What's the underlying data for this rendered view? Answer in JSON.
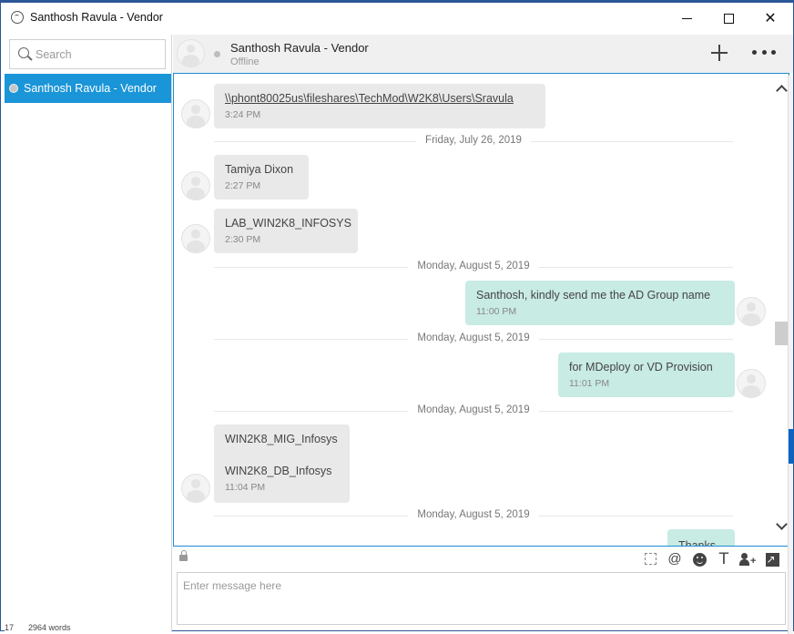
{
  "window": {
    "title": "Santhosh Ravula - Vendor",
    "minimize_icon": "minimize-icon",
    "maximize_icon": "maximize-icon",
    "close_glyph": "✕"
  },
  "sidebar": {
    "search_placeholder": "Search",
    "contacts": [
      {
        "label": "Santhosh Ravula - Vendor",
        "status": "offline"
      }
    ]
  },
  "chat_header": {
    "name": "Santhosh Ravula - Vendor",
    "status": "Offline"
  },
  "messages": [
    {
      "type": "in",
      "text": "\\\\phont80025us\\fileshares\\TechMod\\W2K8\\Users\\Sravula",
      "time": "3:24 PM",
      "is_link": true
    },
    {
      "type": "divider",
      "text": "Friday, July 26, 2019"
    },
    {
      "type": "in",
      "text": "Tamiya Dixon",
      "time": "2:27 PM"
    },
    {
      "type": "in",
      "text": "LAB_WIN2K8_INFOSYS",
      "time": "2:30 PM"
    },
    {
      "type": "divider",
      "text": "Monday, August 5, 2019"
    },
    {
      "type": "out",
      "text": "Santhosh, kindly send me the AD Group name",
      "time": "11:00 PM"
    },
    {
      "type": "divider",
      "text": "Monday, August 5, 2019"
    },
    {
      "type": "out",
      "text": "for MDeploy or VD Provision",
      "time": "11:01 PM"
    },
    {
      "type": "divider",
      "text": "Monday, August 5, 2019"
    },
    {
      "type": "in",
      "text_lines": [
        "WIN2K8_MIG_Infosys",
        "WIN2K8_DB_Infosys"
      ],
      "time": "11:04 PM"
    },
    {
      "type": "divider",
      "text": "Monday, August 5, 2019"
    },
    {
      "type": "out",
      "text": "Thanks"
    }
  ],
  "toolbar": {
    "mention_glyph": "@",
    "format_glyph": "T",
    "add_person_glyph": "+"
  },
  "composer": {
    "placeholder": "Enter message here"
  },
  "background_app": {
    "status_items": [
      "17",
      "2964 words"
    ]
  },
  "colors": {
    "accent": "#1a95d8",
    "incoming_bubble": "#e9e9e9",
    "outgoing_bubble": "#c8ebe3"
  }
}
